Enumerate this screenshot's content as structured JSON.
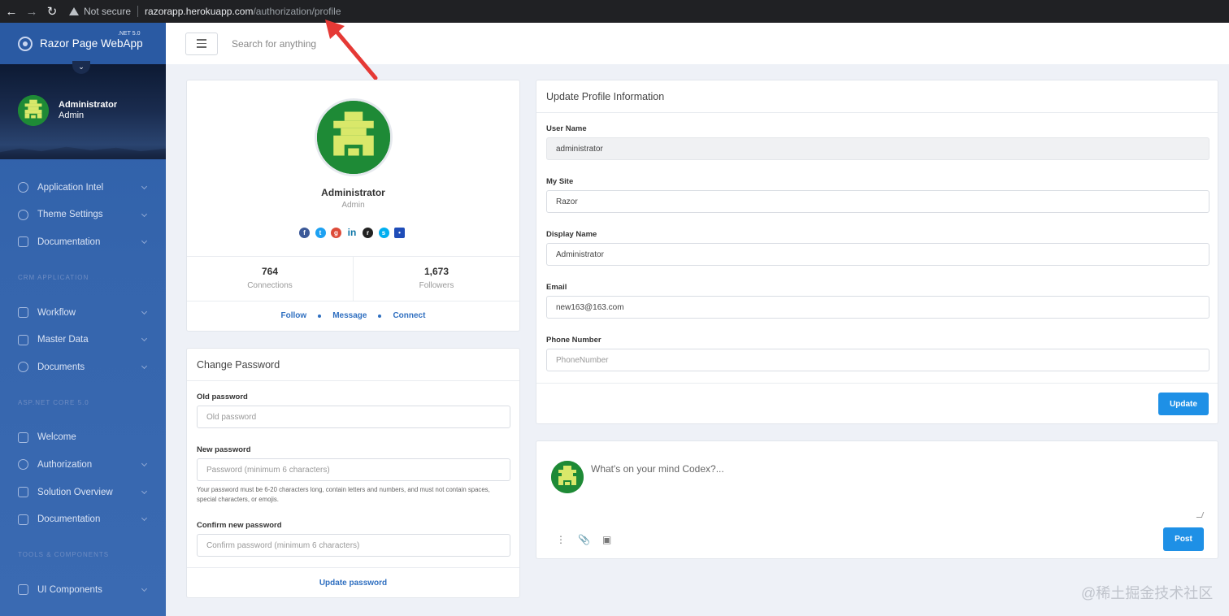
{
  "browser": {
    "security_label": "Not secure",
    "url_host": "razorapp.herokuapp.com",
    "url_path": "/authorization/profile"
  },
  "sidebar": {
    "brand_name": "Razor Page WebApp",
    "brand_version": ".NET 5.0",
    "user": {
      "name": "Administrator",
      "role": "Admin"
    },
    "items_top": [
      {
        "label": "Application Intel"
      },
      {
        "label": "Theme Settings"
      },
      {
        "label": "Documentation"
      }
    ],
    "section_crm": "CRM APPLICATION",
    "items_crm": [
      {
        "label": "Workflow"
      },
      {
        "label": "Master Data"
      },
      {
        "label": "Documents"
      }
    ],
    "section_asp": "ASP.NET CORE 5.0",
    "items_asp": [
      {
        "label": "Welcome"
      },
      {
        "label": "Authorization"
      },
      {
        "label": "Solution Overview"
      },
      {
        "label": "Documentation"
      }
    ],
    "section_tools": "TOOLS & COMPONENTS",
    "items_tools": [
      {
        "label": "UI Components"
      }
    ]
  },
  "header": {
    "search_placeholder": "Search for anything"
  },
  "profile": {
    "name": "Administrator",
    "role": "Admin",
    "social_icons": [
      "facebook-icon",
      "twitter-icon",
      "google-plus-icon",
      "linkedin-icon",
      "reddit-icon",
      "skype-icon",
      "flickr-icon"
    ],
    "connections_count": "764",
    "connections_label": "Connections",
    "followers_count": "1,673",
    "followers_label": "Followers",
    "follow_label": "Follow",
    "message_label": "Message",
    "connect_label": "Connect"
  },
  "change_password": {
    "title": "Change Password",
    "old_label": "Old password",
    "old_placeholder": "Old password",
    "new_label": "New password",
    "new_placeholder": "Password (minimum 6 characters)",
    "help_text": "Your password must be 6-20 characters long, contain letters and numbers, and must not contain spaces, special characters, or emojis.",
    "confirm_label": "Confirm new password",
    "confirm_placeholder": "Confirm password (minimum 6 characters)",
    "submit_label": "Update password"
  },
  "update_profile": {
    "title": "Update Profile Information",
    "username_label": "User Name",
    "username_value": "administrator",
    "site_label": "My Site",
    "site_value": "Razor",
    "display_label": "Display Name",
    "display_value": "Administrator",
    "email_label": "Email",
    "email_value": "new163@163.com",
    "phone_label": "Phone Number",
    "phone_placeholder": "PhoneNumber",
    "submit_label": "Update"
  },
  "post": {
    "placeholder": "What's on your mind Codex?...",
    "submit_label": "Post"
  },
  "watermark": "@稀土掘金技术社区",
  "colors": {
    "sidebar": "#2d5fa8",
    "primary_button": "#1e90e6",
    "link": "#2f6fc0",
    "avatar_bg": "#1e8a36",
    "avatar_fg": "#d9e86a",
    "annotation_arrow": "#e53935"
  }
}
